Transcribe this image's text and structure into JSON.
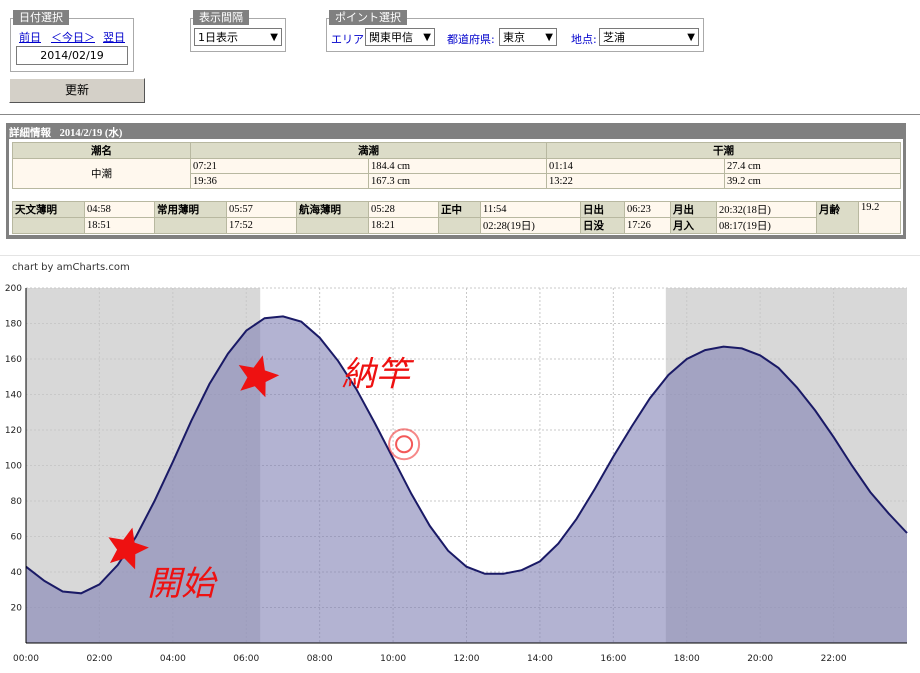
{
  "date_group": {
    "title": "日付選択",
    "prev": "前日",
    "today": "＜今日＞",
    "next": "翌日",
    "date_value": "2014/02/19"
  },
  "interval_group": {
    "title": "表示間隔",
    "selected": "1日表示"
  },
  "point_group": {
    "title": "ポイント選択",
    "area_label": "エリア:",
    "area_value": "関東甲信",
    "pref_label": "都道府県:",
    "pref_value": "東京",
    "spot_label": "地点:",
    "spot_value": "芝浦"
  },
  "update_button": "更新",
  "detail": {
    "title": "詳細情報",
    "date": "2014/2/19 (水)",
    "tide_name_header": "潮名",
    "high_header": "満潮",
    "low_header": "干潮",
    "tide_name": "中潮",
    "high": [
      {
        "time": "07:21",
        "level": "184.4 cm"
      },
      {
        "time": "19:36",
        "level": "167.3 cm"
      }
    ],
    "low": [
      {
        "time": "01:14",
        "level": "27.4 cm"
      },
      {
        "time": "13:22",
        "level": "39.2 cm"
      }
    ],
    "twilight": {
      "astro_label": "天文薄明",
      "astro": [
        "04:58",
        "18:51"
      ],
      "civil_label": "常用薄明",
      "civil": [
        "05:57",
        "17:52"
      ],
      "nautical_label": "航海薄明",
      "nautical": [
        "05:28",
        "18:21"
      ],
      "noon_label": "正中",
      "noon": [
        "11:54",
        "02:28(19日)"
      ],
      "sunrise_label": "日出",
      "sunrise": "06:23",
      "sunset_label": "日没",
      "sunset": "17:26",
      "moonrise_label": "月出",
      "moonrise": "20:32(18日)",
      "moonset_label": "月入",
      "moonset": "08:17(19日)",
      "moon_age_label": "月齢",
      "moon_age": "19.2"
    }
  },
  "chart_credit": "chart by amCharts.com",
  "annotations": {
    "start": "開始",
    "fishing": "納竿"
  },
  "colors": {
    "night_shade": "#d8d8d8",
    "area_fill": "#8080b4",
    "line": "#1a1a66",
    "annotation": "#ee1111",
    "grid": "#c8c8c8"
  },
  "chart_data": {
    "type": "area",
    "title": "",
    "xlabel": "",
    "ylabel": "",
    "x_ticks": [
      "00:00",
      "02:00",
      "04:00",
      "06:00",
      "08:00",
      "10:00",
      "12:00",
      "14:00",
      "16:00",
      "18:00",
      "20:00",
      "22:00"
    ],
    "y_ticks": [
      20,
      40,
      60,
      80,
      100,
      120,
      140,
      160,
      180,
      200
    ],
    "xlim": [
      0,
      24
    ],
    "ylim": [
      0,
      200
    ],
    "grid": true,
    "daylight": {
      "from": 6.38,
      "to": 17.43
    },
    "series": [
      {
        "x": [
          0,
          0.5,
          1,
          1.5,
          2,
          2.5,
          3,
          3.5,
          4,
          4.5,
          5,
          5.5,
          6,
          6.5,
          7,
          7.5,
          8,
          8.5,
          9,
          9.5,
          10,
          10.5,
          11,
          11.5,
          12,
          12.5,
          13,
          13.5,
          14,
          14.5,
          15,
          15.5,
          16,
          16.5,
          17,
          17.5,
          18,
          18.5,
          19,
          19.5,
          20,
          20.5,
          21,
          21.5,
          22,
          22.5,
          23,
          23.5,
          24
        ],
        "y": [
          43,
          35,
          29,
          28,
          33,
          44,
          60,
          80,
          102,
          125,
          146,
          163,
          176,
          183,
          184,
          181,
          172,
          159,
          143,
          124,
          104,
          84,
          66,
          52,
          43,
          39,
          39,
          41,
          46,
          56,
          70,
          87,
          105,
          122,
          138,
          151,
          160,
          165,
          167,
          166,
          162,
          155,
          144,
          131,
          116,
          100,
          85,
          73,
          62
        ]
      }
    ],
    "markers": [
      {
        "x": 2.75,
        "y": 53,
        "label": "開始"
      },
      {
        "x": 6.3,
        "y": 150,
        "label": "納竿"
      },
      {
        "x": 10.3,
        "y": 112
      }
    ]
  }
}
